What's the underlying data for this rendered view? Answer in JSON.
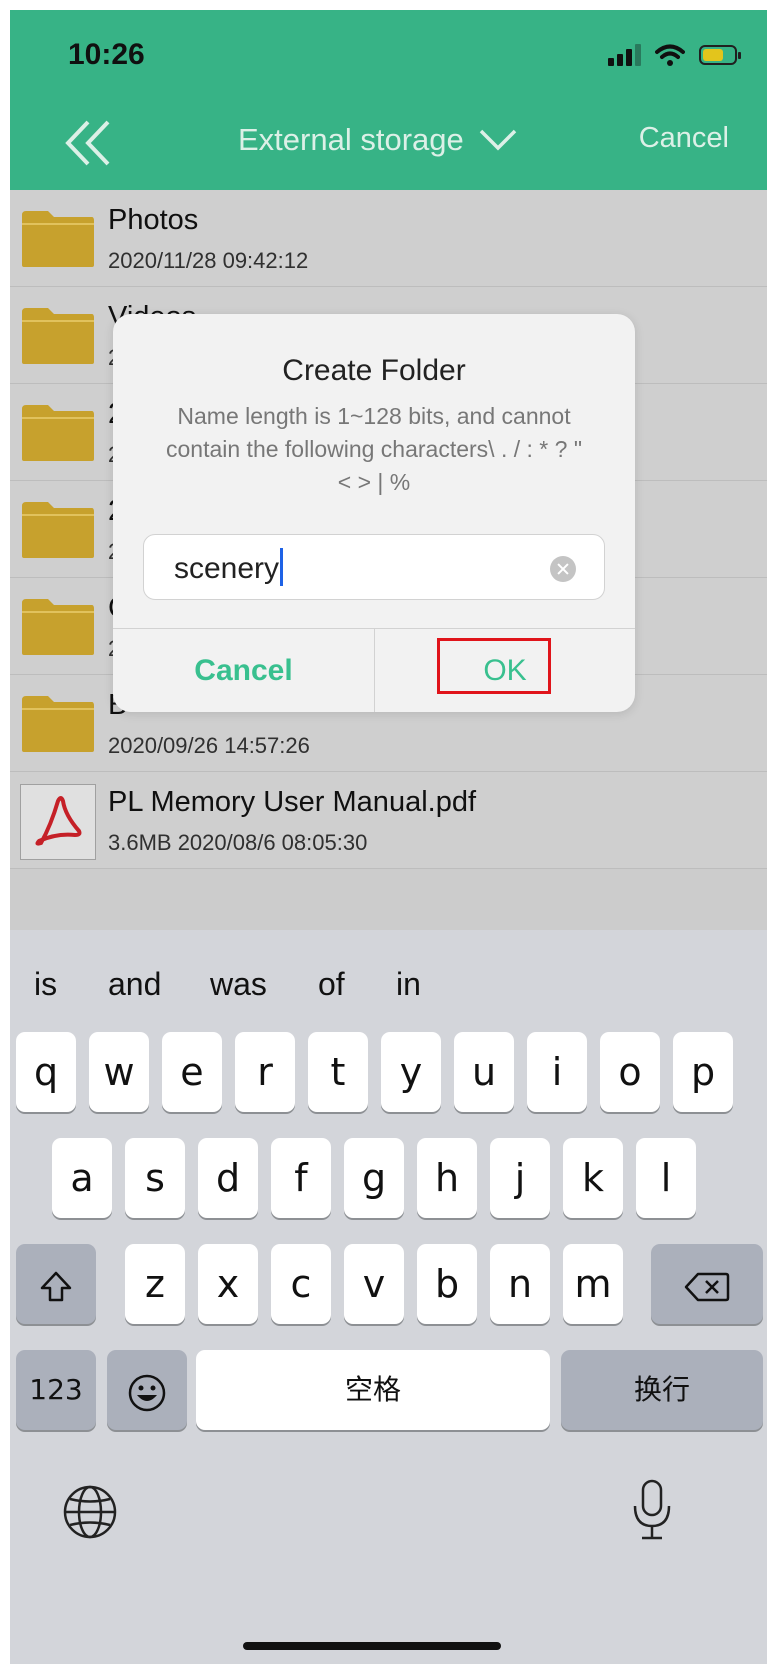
{
  "status_bar": {
    "time": "10:26"
  },
  "header": {
    "title": "External storage",
    "cancel_label": "Cancel"
  },
  "files": [
    {
      "name": "Photos",
      "meta": "2020/11/28 09:42:12",
      "type": "folder"
    },
    {
      "name": "Videos",
      "meta": "2",
      "type": "folder"
    },
    {
      "name": "2",
      "meta": "2",
      "type": "folder"
    },
    {
      "name": "2",
      "meta": "2",
      "type": "folder"
    },
    {
      "name": "C",
      "meta": "2",
      "type": "folder"
    },
    {
      "name": "B",
      "meta": "2020/09/26 14:57:26",
      "type": "folder"
    },
    {
      "name": "PL Memory User Manual.pdf",
      "meta": "3.6MB 2020/08/6 08:05:30",
      "type": "pdf"
    }
  ],
  "dialog": {
    "title": "Create Folder",
    "message": "Name length is 1~128 bits, and cannot contain the following characters\\ . / : * ? \" < > | %",
    "input_value": "scenery",
    "cancel_label": "Cancel",
    "ok_label": "OK"
  },
  "keyboard": {
    "suggestions": [
      "is",
      "and",
      "was",
      "of",
      "in"
    ],
    "row1": [
      "q",
      "w",
      "e",
      "r",
      "t",
      "y",
      "u",
      "i",
      "o",
      "p"
    ],
    "row2": [
      "a",
      "s",
      "d",
      "f",
      "g",
      "h",
      "j",
      "k",
      "l"
    ],
    "row3": [
      "z",
      "x",
      "c",
      "v",
      "b",
      "n",
      "m"
    ],
    "numbers_label": "123",
    "space_label": "空格",
    "return_label": "换行"
  },
  "colors": {
    "accent": "#3bbf8f",
    "highlight": "#e0141b",
    "folder": "#d4ac30"
  }
}
